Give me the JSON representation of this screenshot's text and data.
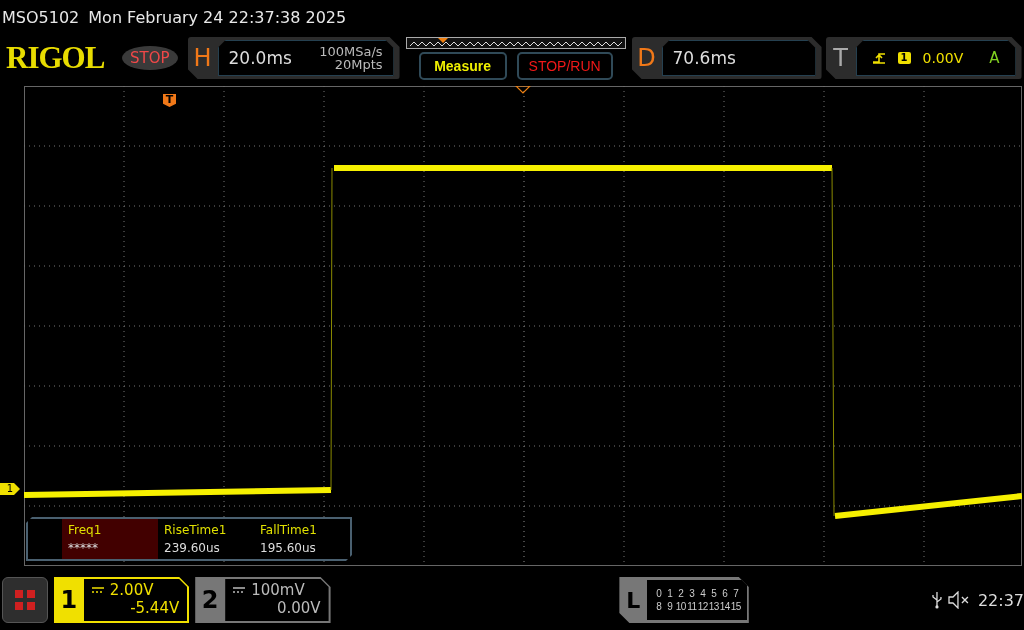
{
  "title": {
    "model": "MSO5102",
    "datetime": "Mon February 24 22:37:38 2025"
  },
  "header": {
    "logo": "RIGOL",
    "run_state": "STOP",
    "horizontal": {
      "label": "H",
      "timebase": "20.0ms",
      "sample_rate": "100MSa/s",
      "memory_depth": "20Mpts"
    },
    "measure_button": "Measure",
    "stop_run_button": "STOP/RUN",
    "delay": {
      "label": "D",
      "value": "70.6ms"
    },
    "trigger": {
      "label": "T",
      "source": "1",
      "level": "0.00V",
      "mode": "A"
    }
  },
  "display": {
    "trigger_marker": "T",
    "channel_marker": "1"
  },
  "measurements": [
    {
      "name": "Freq1",
      "value": "*****",
      "selected": true
    },
    {
      "name": "RiseTime1",
      "value": "239.60us",
      "selected": false
    },
    {
      "name": "FallTime1",
      "value": "195.60us",
      "selected": false
    }
  ],
  "channels": [
    {
      "number": "1",
      "scale": "2.00V",
      "offset": "-5.44V",
      "selected": true
    },
    {
      "number": "2",
      "scale": "100mV",
      "offset": "0.00V",
      "selected": false
    }
  ],
  "logic": {
    "label": "L",
    "rows": [
      [
        "0",
        "1",
        "2",
        "3",
        "4",
        "5",
        "6",
        "7"
      ],
      [
        "8",
        "9",
        "10",
        "11",
        "12",
        "13",
        "14",
        "15"
      ]
    ]
  },
  "status": {
    "time": "22:37"
  }
}
